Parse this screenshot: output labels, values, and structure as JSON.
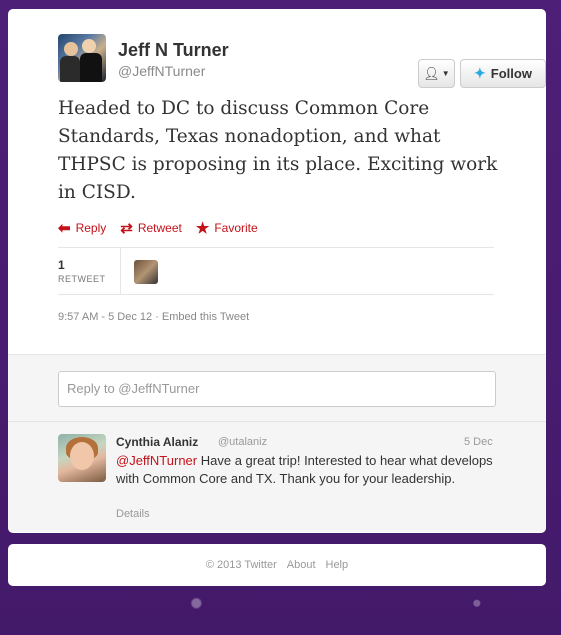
{
  "tweet": {
    "author_name": "Jeff N Turner",
    "author_handle": "@JeffNTurner",
    "text": "Headed to DC to discuss Common Core Standards, Texas nonadoption, and what THPSC is proposing in its place. Exciting work in CISD.",
    "follow_label": "Follow",
    "actions": {
      "reply": "Reply",
      "retweet": "Retweet",
      "favorite": "Favorite"
    },
    "stats": {
      "retweet_count": "1",
      "retweet_label": "RETWEET"
    },
    "timestamp": "9:57 AM - 5 Dec 12 · Embed this Tweet"
  },
  "reply_box": {
    "placeholder": "Reply to @JeffNTurner"
  },
  "reply": {
    "author_name": "Cynthia Alaniz",
    "author_handle": "@utalaniz",
    "date": "5 Dec",
    "mention": "@JeffNTurner",
    "text": " Have a great trip! Interested to hear what develops with Common Core and TX. Thank you for your leadership.",
    "details_label": "Details"
  },
  "footer": {
    "copyright": "© 2013 Twitter",
    "about": "About",
    "help": "Help"
  },
  "colors": {
    "accent": "#c4121b",
    "background": "#4a2070",
    "twitter_blue": "#2aa9e0"
  }
}
